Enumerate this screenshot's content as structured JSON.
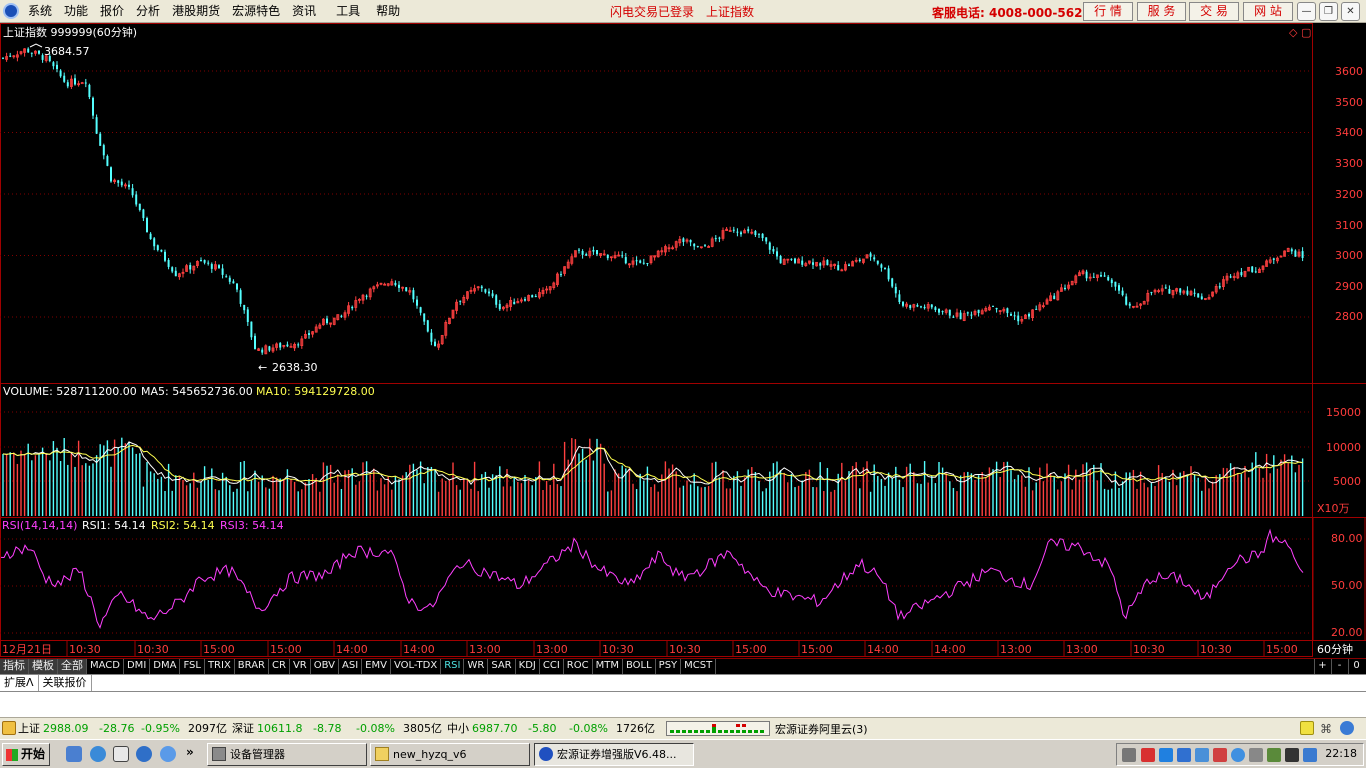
{
  "menu": {
    "items": [
      "系统",
      "功能",
      "报价",
      "分析",
      "港股期货",
      "宏源特色",
      "资讯",
      "工具",
      "帮助"
    ],
    "flash_status": "闪电交易已登录",
    "current_index": "上证指数",
    "hotline": "客服电话: 4008-000-562",
    "quick_buttons": [
      "行 情",
      "服 务",
      "交 易",
      "网 站"
    ],
    "window_controls": [
      "—",
      "❐",
      "✕"
    ]
  },
  "chart": {
    "title": "上证指数 999999(60分钟)",
    "high_label": "3684.57",
    "low_label": "2638.30",
    "price_axis": [
      "3600",
      "3500",
      "3400",
      "3300",
      "3200",
      "3100",
      "3000",
      "2900",
      "2800"
    ],
    "volume_header": {
      "volume": "VOLUME: 528711200.00",
      "ma5": "MA5: 545652736.00",
      "ma10": "MA10: 594129728.00"
    },
    "volume_axis": [
      "15000",
      "10000",
      "5000"
    ],
    "volume_unit": "X10万",
    "rsi_header": {
      "name": "RSI(14,14,14)",
      "rsi1": "RSI1: 54.14",
      "rsi2": "RSI2: 54.14",
      "rsi3": "RSI3: 54.14"
    },
    "rsi_axis": [
      "80.00",
      "50.00",
      "20.00"
    ],
    "time_axis": [
      "12月21日",
      "10:30",
      "10:30",
      "15:00",
      "15:00",
      "14:00",
      "14:00",
      "13:00",
      "13:00",
      "10:30",
      "10:30",
      "15:00",
      "15:00",
      "14:00",
      "14:00",
      "13:00",
      "13:00",
      "10:30",
      "10:30",
      "15:00"
    ],
    "period_label": "60分钟",
    "colors": {
      "up": "#ff4040",
      "down": "#54ffff",
      "volume_ma5": "#ffffff",
      "volume_ma10": "#ffff50",
      "rsi": "#ff40ff",
      "grid": "#800000",
      "axis_text": "#ff3c3c"
    }
  },
  "indicator_tabs": {
    "grey": [
      "指标",
      "模板",
      "全部"
    ],
    "items": [
      "MACD",
      "DMI",
      "DMA",
      "FSL",
      "TRIX",
      "BRAR",
      "CR",
      "VR",
      "OBV",
      "ASI",
      "EMV",
      "VOL-TDX",
      "RSI",
      "WR",
      "SAR",
      "KDJ",
      "CCI",
      "ROC",
      "MTM",
      "BOLL",
      "PSY",
      "MCST"
    ],
    "active": "RSI",
    "controls": [
      "+",
      "-",
      "0"
    ]
  },
  "extension_tabs": [
    "扩展Λ",
    "关联报价"
  ],
  "status": {
    "sh_name": "上证",
    "sh_value": "2988.09",
    "sh_change": "-28.76",
    "sh_pct": "-0.95%",
    "sh_amount": "2097亿",
    "sz_name": "深证",
    "sz_value": "10611.8",
    "sz_change": "-8.78",
    "sz_pct": "-0.08%",
    "sz_amount": "3805亿",
    "zx_name": "中小",
    "zx_value": "6987.70",
    "zx_change": "-5.80",
    "zx_pct": "-0.08%",
    "zx_amount": "1726亿",
    "broker": "宏源证券阿里云(3)"
  },
  "taskbar": {
    "start": "开始",
    "tasks": [
      "设备管理器",
      "new_hyzq_v6",
      "宏源证券增强版V6.48..."
    ],
    "clock": "22:18",
    "quick_launch_more": "»"
  }
}
